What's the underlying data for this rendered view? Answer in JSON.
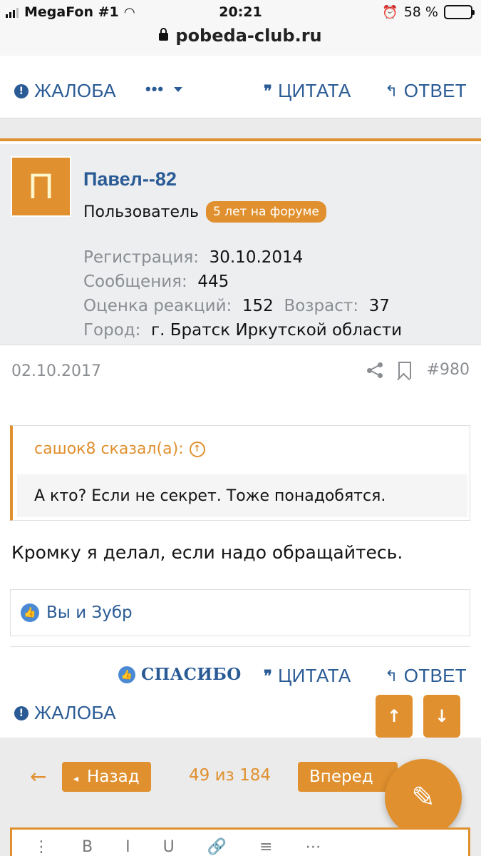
{
  "status_bar": {
    "carrier": "MegaFon #1",
    "time": "20:21",
    "battery": "58 %",
    "url": "pobeda-club.ru"
  },
  "prev_post_actions": {
    "report": "ЖАЛОБА",
    "more": "•••",
    "quote": "ЦИТАТА",
    "reply": "ОТВЕТ"
  },
  "post": {
    "avatar_letter": "П",
    "username": "Павел--82",
    "user_title": "Пользователь",
    "badge": "5 лет на форуме",
    "stats": {
      "registration_label": "Регистрация:",
      "registration_value": "30.10.2014",
      "messages_label": "Сообщения:",
      "messages_value": "445",
      "reactions_label": "Оценка реакций:",
      "reactions_value": "152",
      "age_label": "Возраст:",
      "age_value": "37",
      "city_label": "Город:",
      "city_value": "г. Братск Иркутской области"
    },
    "date": "02.10.2017",
    "post_number": "#980",
    "quote_author": "сашок8 сказал(а):",
    "quote_text": "А кто? Если не секрет. Тоже понадобятся.",
    "text": "Кромку я делал, если надо обращайтесь.",
    "reactions_text": "Вы и Зубр",
    "actions": {
      "thanks": "СПАСИБО",
      "quote": "ЦИТАТА",
      "reply": "ОТВЕТ",
      "report": "ЖАЛОБА"
    }
  },
  "pager": {
    "back": "Назад",
    "info": "49 из 184",
    "forward": "Вперед"
  },
  "colors": {
    "accent": "#e0902e",
    "link": "#2a5b95"
  }
}
